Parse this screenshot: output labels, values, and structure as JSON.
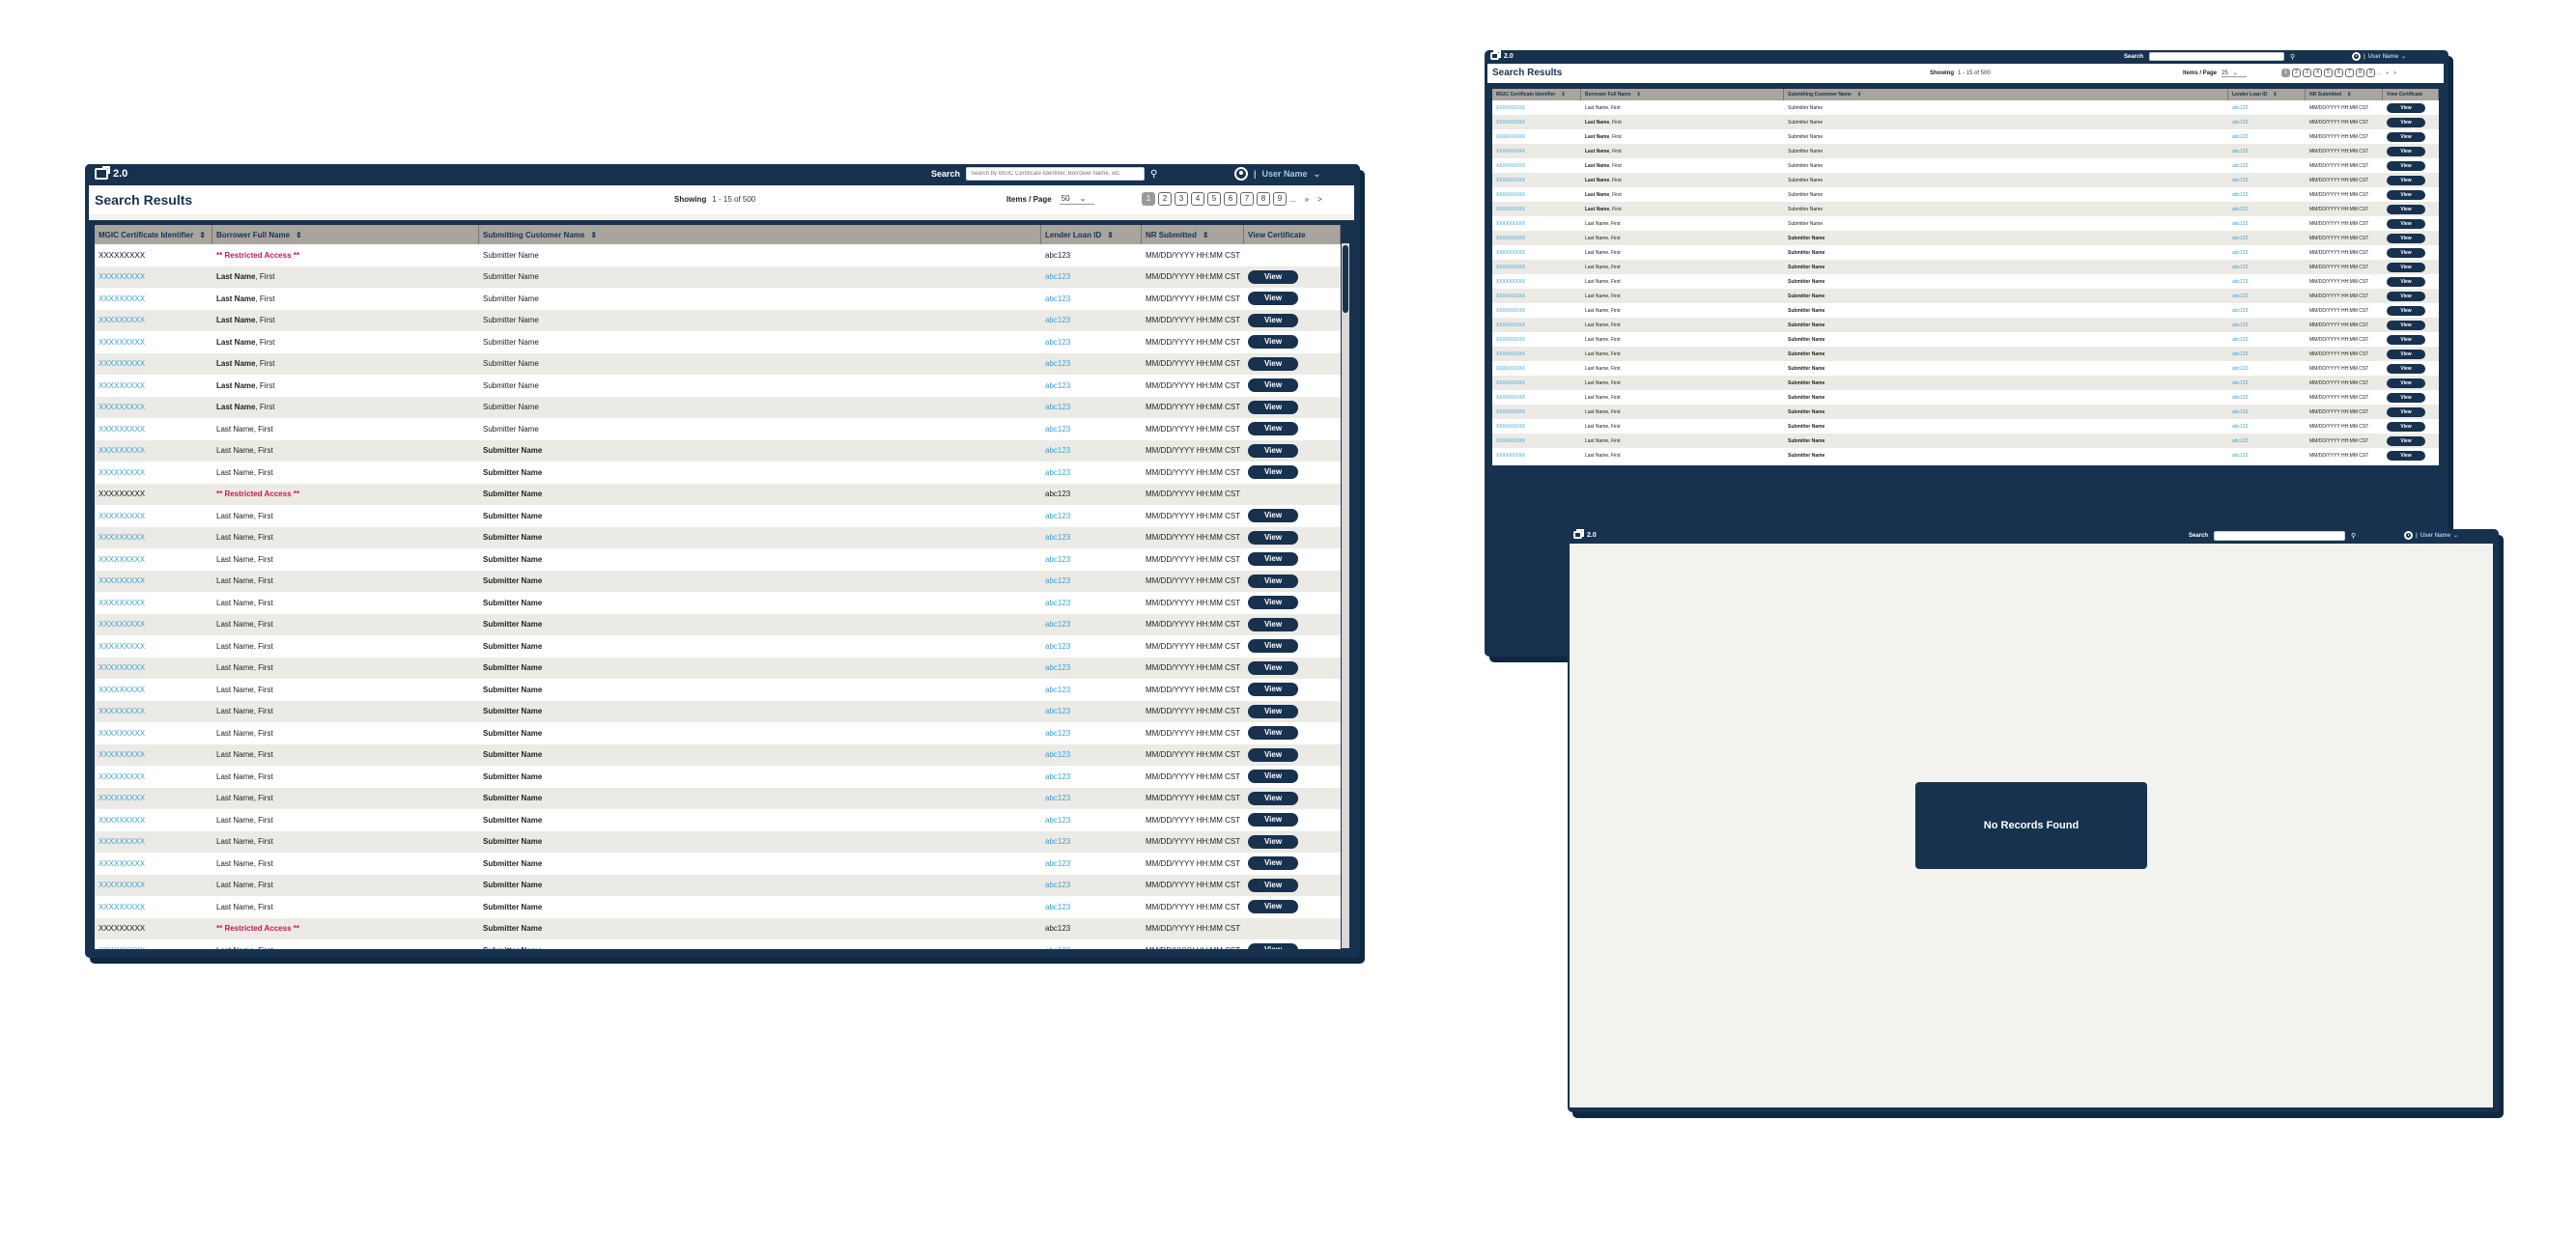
{
  "app": {
    "version": "2.0",
    "search_label": "Search",
    "search_placeholder": "Search by MGIC Certificate Identifier, Borrower Name, etc.",
    "user_name": "User Name"
  },
  "results": {
    "title": "Search Results",
    "showing_label": "Showing",
    "showing_range_main": "1 - 15 of  500",
    "showing_range_alt": "1 - 15 of 500",
    "items_per_page_label": "Items / Page",
    "items_per_page_main": "50",
    "items_per_page_alt": "25",
    "pages": [
      "1",
      "2",
      "3",
      "4",
      "5",
      "6",
      "7",
      "8",
      "9"
    ],
    "ellipsis": "...",
    "next_group": "»",
    "next": ">"
  },
  "table": {
    "columns": [
      "MGIC Certificate Identifier",
      "Borrower Full Name",
      "Submitting Customer Name",
      "Lender Loan ID",
      "NR Submitted",
      "View Certificate"
    ],
    "sort_icon": "sort-icon",
    "view_label": "View",
    "cert_id": "XXXXXXXXX",
    "restricted_text": "** Restricted Access **",
    "borrower_last": "Last Name",
    "borrower_first": ", First",
    "submitter": "Submitter Name",
    "loan_id": "abc123",
    "date": "MM/DD/YYYY HH:MM CST"
  },
  "main_rows": [
    {
      "restricted": true,
      "bold_name": false,
      "bold_sub": false
    },
    {
      "restricted": false,
      "bold_name": true,
      "bold_sub": false
    },
    {
      "restricted": false,
      "bold_name": true,
      "bold_sub": false
    },
    {
      "restricted": false,
      "bold_name": true,
      "bold_sub": false
    },
    {
      "restricted": false,
      "bold_name": true,
      "bold_sub": false
    },
    {
      "restricted": false,
      "bold_name": true,
      "bold_sub": false
    },
    {
      "restricted": false,
      "bold_name": true,
      "bold_sub": false
    },
    {
      "restricted": false,
      "bold_name": true,
      "bold_sub": false
    },
    {
      "restricted": false,
      "bold_name": false,
      "bold_sub": false
    },
    {
      "restricted": false,
      "bold_name": false,
      "bold_sub": true
    },
    {
      "restricted": false,
      "bold_name": false,
      "bold_sub": true
    },
    {
      "restricted": true,
      "bold_name": false,
      "bold_sub": true
    },
    {
      "restricted": false,
      "bold_name": false,
      "bold_sub": true
    },
    {
      "restricted": false,
      "bold_name": false,
      "bold_sub": true
    },
    {
      "restricted": false,
      "bold_name": false,
      "bold_sub": true
    },
    {
      "restricted": false,
      "bold_name": false,
      "bold_sub": true
    },
    {
      "restricted": false,
      "bold_name": false,
      "bold_sub": true
    },
    {
      "restricted": false,
      "bold_name": false,
      "bold_sub": true
    },
    {
      "restricted": false,
      "bold_name": false,
      "bold_sub": true
    },
    {
      "restricted": false,
      "bold_name": false,
      "bold_sub": true
    },
    {
      "restricted": false,
      "bold_name": false,
      "bold_sub": true
    },
    {
      "restricted": false,
      "bold_name": false,
      "bold_sub": true
    },
    {
      "restricted": false,
      "bold_name": false,
      "bold_sub": true
    },
    {
      "restricted": false,
      "bold_name": false,
      "bold_sub": true
    },
    {
      "restricted": false,
      "bold_name": false,
      "bold_sub": true
    },
    {
      "restricted": false,
      "bold_name": false,
      "bold_sub": true
    },
    {
      "restricted": false,
      "bold_name": false,
      "bold_sub": true
    },
    {
      "restricted": false,
      "bold_name": false,
      "bold_sub": true
    },
    {
      "restricted": false,
      "bold_name": false,
      "bold_sub": true
    },
    {
      "restricted": false,
      "bold_name": false,
      "bold_sub": true
    },
    {
      "restricted": false,
      "bold_name": false,
      "bold_sub": true
    },
    {
      "restricted": true,
      "bold_name": false,
      "bold_sub": true
    },
    {
      "restricted": false,
      "bold_name": false,
      "bold_sub": true
    }
  ],
  "alt_rows": [
    {
      "bold_name": false,
      "bold_sub": false
    },
    {
      "bold_name": true,
      "bold_sub": false
    },
    {
      "bold_name": true,
      "bold_sub": false
    },
    {
      "bold_name": true,
      "bold_sub": false
    },
    {
      "bold_name": true,
      "bold_sub": false
    },
    {
      "bold_name": true,
      "bold_sub": false
    },
    {
      "bold_name": true,
      "bold_sub": false
    },
    {
      "bold_name": true,
      "bold_sub": false
    },
    {
      "bold_name": false,
      "bold_sub": false
    },
    {
      "bold_name": false,
      "bold_sub": true
    },
    {
      "bold_name": false,
      "bold_sub": true
    },
    {
      "bold_name": false,
      "bold_sub": true
    },
    {
      "bold_name": false,
      "bold_sub": true
    },
    {
      "bold_name": false,
      "bold_sub": true
    },
    {
      "bold_name": false,
      "bold_sub": true
    },
    {
      "bold_name": false,
      "bold_sub": true
    },
    {
      "bold_name": false,
      "bold_sub": true
    },
    {
      "bold_name": false,
      "bold_sub": true
    },
    {
      "bold_name": false,
      "bold_sub": true
    },
    {
      "bold_name": false,
      "bold_sub": true
    },
    {
      "bold_name": false,
      "bold_sub": true
    },
    {
      "bold_name": false,
      "bold_sub": true
    },
    {
      "bold_name": false,
      "bold_sub": true
    },
    {
      "bold_name": false,
      "bold_sub": true
    },
    {
      "bold_name": false,
      "bold_sub": true
    }
  ],
  "no_records": {
    "message": "No Records Found"
  },
  "colors": {
    "navy": "#17324f",
    "link": "#3aa0d8",
    "restricted": "#c2185b",
    "header_gray": "#a9a49e",
    "stripe": "#eceae4",
    "panel": "#f2f2ee"
  }
}
